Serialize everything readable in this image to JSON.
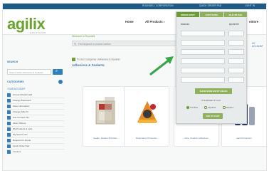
{
  "util_bar": {
    "links": [
      "ROUNDELL CORPORATION",
      "QUICK ORDER PAD",
      "LIGHT IN"
    ]
  },
  "header": {
    "logo_text": "agilix",
    "logo_tagline": "SOLUTIONS",
    "nav": [
      {
        "label": "Home"
      },
      {
        "label": "All Products"
      },
      {
        "label": "eStore"
      }
    ]
  },
  "breadcrumb_top": "Welcome to Roundell",
  "search_bar": {
    "placeholder": "Find keyword or product number"
  },
  "account_link": "MY ACCOUNT",
  "sidebar": {
    "search_heading": "SEARCH",
    "search_placeholder": "Search within Adhesives & Sealants",
    "categories_heading": "CATEGORIES",
    "subheading": "YOUR ACCOUNT",
    "items": [
      "Account Dashboard",
      "Change Password",
      "Save Information",
      "Change Ship To",
      "Site Contact Info",
      "Order History",
      "My Products & Lists",
      "My Saved Cart",
      "Request for Quote",
      "Quick Order Pad",
      "Invoices"
    ]
  },
  "main": {
    "breadcrumb": "Product Categories | Adhesives & Sealants",
    "title": "Adhesives & Sealants",
    "products": [
      {
        "caption": "Sealer, Sealant & Putties"
      },
      {
        "caption": "Respiratory Protection"
      },
      {
        "caption": "Glue, Sealant, Adhesives"
      },
      {
        "caption": "Hand Protection"
      }
    ]
  },
  "quick_order_panel": {
    "tabs": [
      "ORDER ENTRY",
      "COPY PASTE",
      "FILE UPLOAD"
    ],
    "active_tab": "ORDER ENTRY",
    "col_sku": "ITEM NO.",
    "col_qty": "QUANTITY",
    "row_count": 6,
    "add_more_label": "SHOW MORE ENTRY FIELDS",
    "question": "If Duplicates in Cart:",
    "radio_options": [
      "Combine",
      "Separate",
      "Replace"
    ],
    "radio_selected": "Combine",
    "add_label": "ADD TO CART"
  },
  "colors": {
    "brand_green": "#6aa42f",
    "nav_blue": "#1f5b86",
    "link_blue": "#3a7bb0",
    "arrow_green": "#3aa54a"
  }
}
